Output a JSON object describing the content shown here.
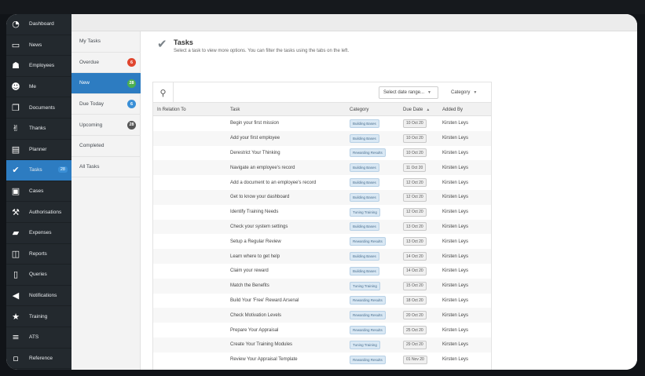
{
  "sidebar": {
    "items": [
      {
        "label": "Dashboard",
        "icon": "dashboard-icon",
        "glyph": "◔"
      },
      {
        "label": "News",
        "icon": "tv-icon",
        "glyph": "▭"
      },
      {
        "label": "Employees",
        "icon": "users-icon",
        "glyph": "☗"
      },
      {
        "label": "Me",
        "icon": "user-icon",
        "glyph": "☻"
      },
      {
        "label": "Documents",
        "icon": "documents-icon",
        "glyph": "❐"
      },
      {
        "label": "Thanks",
        "icon": "thumbs-up-icon",
        "glyph": "✌"
      },
      {
        "label": "Planner",
        "icon": "planner-icon",
        "glyph": "▤"
      },
      {
        "label": "Tasks",
        "icon": "check-icon",
        "glyph": "✔",
        "count": "28",
        "active": true
      },
      {
        "label": "Cases",
        "icon": "cases-icon",
        "glyph": "▣"
      },
      {
        "label": "Authorisations",
        "icon": "hammer-icon",
        "glyph": "⚒"
      },
      {
        "label": "Expenses",
        "icon": "wallet-icon",
        "glyph": "▰"
      },
      {
        "label": "Reports",
        "icon": "reports-icon",
        "glyph": "◫"
      },
      {
        "label": "Queries",
        "icon": "queries-icon",
        "glyph": "▯"
      },
      {
        "label": "Notifications",
        "icon": "megaphone-icon",
        "glyph": "◀"
      },
      {
        "label": "Training",
        "icon": "star-icon",
        "glyph": "★"
      },
      {
        "label": "ATS",
        "icon": "list-icon",
        "glyph": "≡"
      },
      {
        "label": "Reference",
        "icon": "reference-icon",
        "glyph": "▫"
      }
    ]
  },
  "filters": {
    "items": [
      {
        "label": "My Tasks"
      },
      {
        "label": "Overdue",
        "count": "6",
        "color": "#e0462f"
      },
      {
        "label": "New",
        "count": "28",
        "color": "#4caf50",
        "active": true
      },
      {
        "label": "Due Today",
        "count": "6",
        "color": "#3a8fd6"
      },
      {
        "label": "Upcoming",
        "count": "28",
        "color": "#555555"
      },
      {
        "label": "Completed"
      },
      {
        "label": "All Tasks"
      }
    ]
  },
  "header": {
    "title": "Tasks",
    "description": "Select a task to view more options. You can filter the tasks using the tabs on the left."
  },
  "toolbar": {
    "date_range": "Select date range...",
    "category": "Category"
  },
  "table": {
    "columns": [
      "In Relation To",
      "Task",
      "Category",
      "Due Date",
      "Added By"
    ],
    "rows": [
      {
        "relation": "",
        "task": "Begin your first mission",
        "category": "Building Bases",
        "due": "10 Oct 20",
        "added_by": "Kirsten Leys"
      },
      {
        "relation": "",
        "task": "Add your first employee",
        "category": "Building Bases",
        "due": "10 Oct 20",
        "added_by": "Kirsten Leys"
      },
      {
        "relation": "",
        "task": "Derestrict Your Thinking",
        "category": "Rewarding Results",
        "due": "10 Oct 20",
        "added_by": "Kirsten Leys"
      },
      {
        "relation": "",
        "task": "Navigate an employee's record",
        "category": "Building Bases",
        "due": "11 Oct 20",
        "added_by": "Kirsten Leys"
      },
      {
        "relation": "",
        "task": "Add a document to an employee's record",
        "category": "Building Bases",
        "due": "12 Oct 20",
        "added_by": "Kirsten Leys"
      },
      {
        "relation": "",
        "task": "Get to know your dashboard",
        "category": "Building Bases",
        "due": "12 Oct 20",
        "added_by": "Kirsten Leys"
      },
      {
        "relation": "",
        "task": "Identify Training Needs",
        "category": "Tuning Training",
        "due": "12 Oct 20",
        "added_by": "Kirsten Leys"
      },
      {
        "relation": "",
        "task": "Check your system settings",
        "category": "Building Bases",
        "due": "13 Oct 20",
        "added_by": "Kirsten Leys"
      },
      {
        "relation": "",
        "task": "Setup a Regular Review",
        "category": "Rewarding Results",
        "due": "13 Oct 20",
        "added_by": "Kirsten Leys"
      },
      {
        "relation": "",
        "task": "Learn where to get help",
        "category": "Building Bases",
        "due": "14 Oct 20",
        "added_by": "Kirsten Leys"
      },
      {
        "relation": "",
        "task": "Claim your reward",
        "category": "Building Bases",
        "due": "14 Oct 20",
        "added_by": "Kirsten Leys"
      },
      {
        "relation": "",
        "task": "Match the Benefits",
        "category": "Tuning Training",
        "due": "15 Oct 20",
        "added_by": "Kirsten Leys"
      },
      {
        "relation": "",
        "task": "Build Your 'Free' Reward Arsenal",
        "category": "Rewarding Results",
        "due": "18 Oct 20",
        "added_by": "Kirsten Leys"
      },
      {
        "relation": "",
        "task": "Check Motivation Levels",
        "category": "Rewarding Results",
        "due": "20 Oct 20",
        "added_by": "Kirsten Leys"
      },
      {
        "relation": "",
        "task": "Prepare Your Appraisal",
        "category": "Rewarding Results",
        "due": "25 Oct 20",
        "added_by": "Kirsten Leys"
      },
      {
        "relation": "",
        "task": "Create Your Training Modules",
        "category": "Tuning Training",
        "due": "29 Oct 20",
        "added_by": "Kirsten Leys"
      },
      {
        "relation": "",
        "task": "Review Your Appraisal Template",
        "category": "Rewarding Results",
        "due": "01 Nov 20",
        "added_by": "Kirsten Leys"
      }
    ]
  },
  "colors": {
    "sidebar_bg": "#23292e",
    "accent": "#2d7cc1"
  }
}
